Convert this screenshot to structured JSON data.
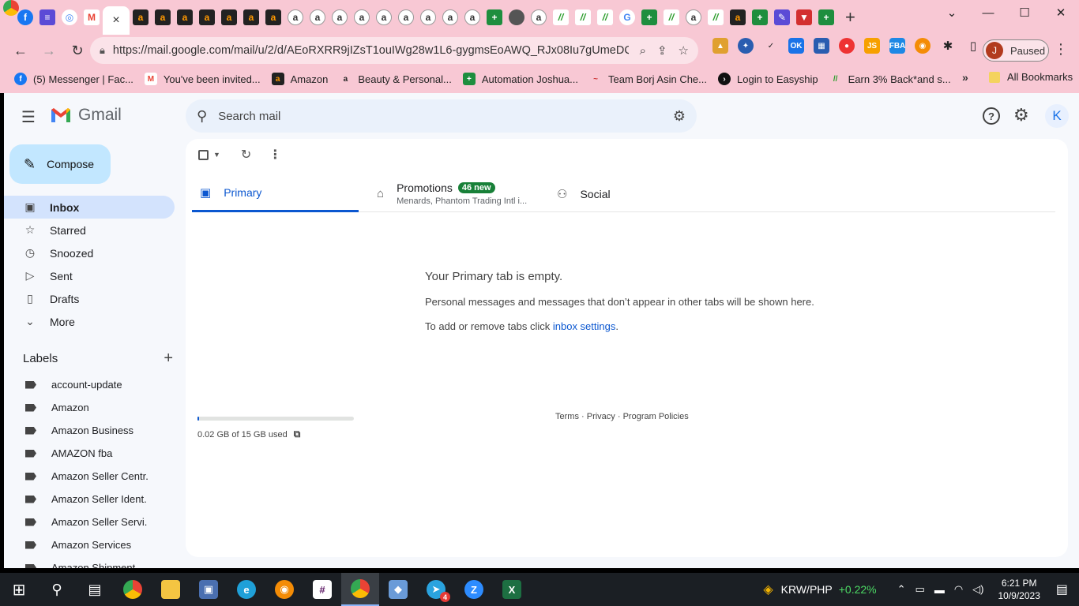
{
  "browser": {
    "active_tab_close": "×",
    "url": "https://mail.google.com/mail/u/2/d/AEoRXRR9jIZsT1ouIWg28w1L6-gygmsEoAWQ_RJx08Iu7gUmeDQ...",
    "profile_name": "Paused",
    "profile_initial": "J",
    "bookmarks": [
      {
        "label": "(5) Messenger | Fac...",
        "icon": "facebook-icon"
      },
      {
        "label": "You've been invited...",
        "icon": "gmail-icon"
      },
      {
        "label": "Amazon",
        "icon": "amazon-icon"
      },
      {
        "label": "Beauty & Personal...",
        "icon": "amazon-icon"
      },
      {
        "label": "Automation Joshua...",
        "icon": "sheets-icon"
      },
      {
        "label": "Team Borj Asin Che...",
        "icon": "team-icon"
      },
      {
        "label": "Login to Easyship",
        "icon": "easyship-icon"
      },
      {
        "label": "Earn 3% Back*and s...",
        "icon": "cashback-icon"
      }
    ],
    "all_bookmarks": "All Bookmarks"
  },
  "gmail": {
    "logo_text": "Gmail",
    "search_placeholder": "Search mail",
    "account_initial": "K",
    "compose_label": "Compose",
    "nav": [
      {
        "label": "Inbox",
        "icon": "inbox-icon"
      },
      {
        "label": "Starred",
        "icon": "star-icon"
      },
      {
        "label": "Snoozed",
        "icon": "clock-icon"
      },
      {
        "label": "Sent",
        "icon": "send-icon"
      },
      {
        "label": "Drafts",
        "icon": "draft-icon"
      },
      {
        "label": "More",
        "icon": "chevron-down-icon"
      }
    ],
    "labels_title": "Labels",
    "labels": [
      "account-update",
      "Amazon",
      "Amazon Business",
      "AMAZON fba",
      "Amazon Seller Centr.",
      "Amazon Seller Ident.",
      "Amazon Seller Servi.",
      "Amazon Services",
      "Amazon Shipment"
    ],
    "tabs": {
      "primary": "Primary",
      "promotions": "Promotions",
      "promotions_badge": "46 new",
      "promotions_sub": "Menards, Phantom Trading Intl i...",
      "social": "Social"
    },
    "empty": {
      "title": "Your Primary tab is empty.",
      "line1": "Personal messages and messages that don’t appear in other tabs will be shown here.",
      "line2_prefix": "To add or remove tabs click ",
      "line2_link": "inbox settings",
      "line2_suffix": "."
    },
    "storage": {
      "text": "0.02 GB of 15 GB used",
      "fraction": 0.0013
    },
    "footer": {
      "terms": "Terms",
      "privacy": "Privacy",
      "policies": "Program Policies",
      "sep": " · "
    }
  },
  "taskbar": {
    "ticker_pair": "KRW/PHP",
    "ticker_change": "+0.22%",
    "time": "6:21 PM",
    "date": "10/9/2023",
    "telegram_badge": "4"
  }
}
